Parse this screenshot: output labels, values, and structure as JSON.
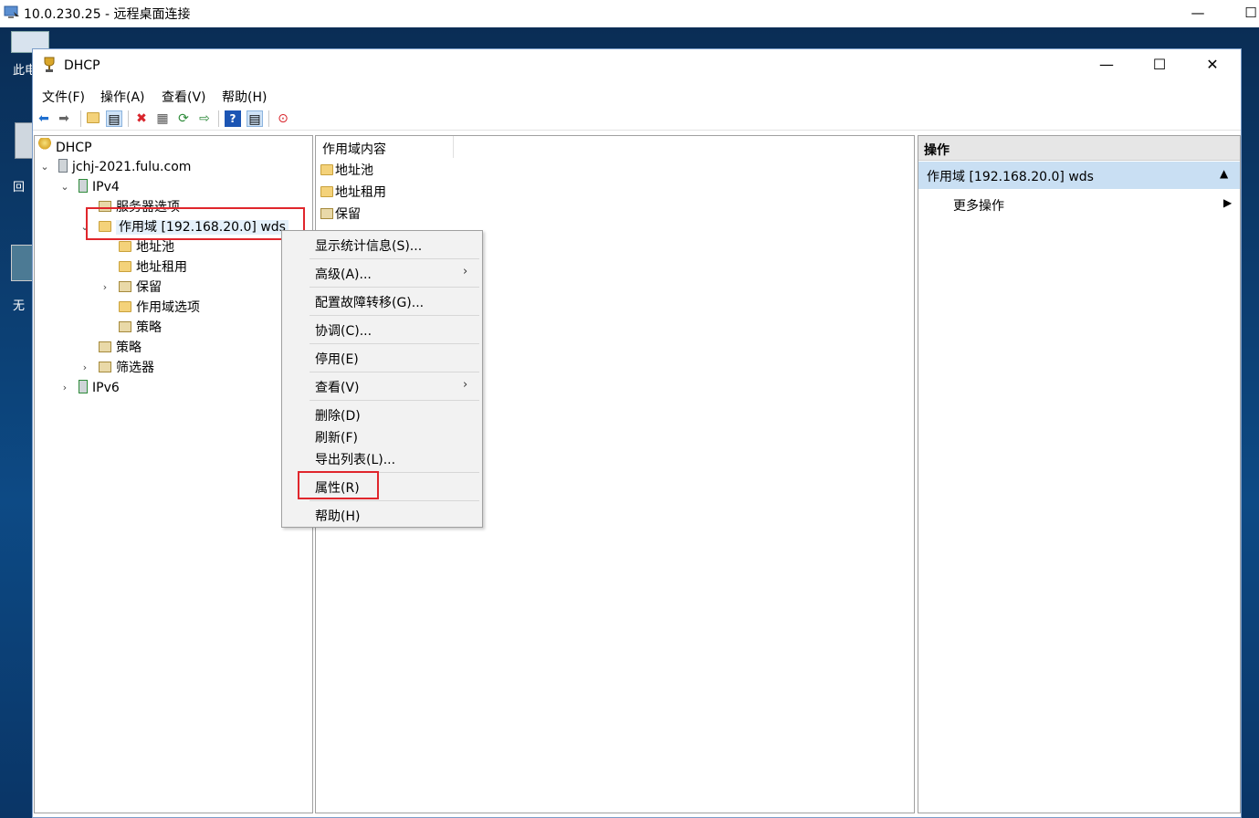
{
  "rdp": {
    "title": "10.0.230.25 - 远程桌面连接",
    "minimize": "—",
    "maximize": "☐"
  },
  "desktop": {
    "labels": [
      "此电",
      "回",
      "无"
    ]
  },
  "window": {
    "title": "DHCP",
    "minimize": "—",
    "maximize": "☐",
    "close": "✕"
  },
  "menubar": [
    "文件(F)",
    "操作(A)",
    "查看(V)",
    "帮助(H)"
  ],
  "toolbar": {
    "icons": [
      "back-arrow-icon",
      "forward-arrow-icon",
      "up-folder-icon",
      "show-hide-tree-icon",
      "delete-icon",
      "properties-icon",
      "refresh-icon",
      "export-list-icon",
      "help-icon",
      "show-hide-action-pane-icon",
      "deactivate-icon"
    ]
  },
  "tree": {
    "root": "DHCP",
    "server": "jchj-2021.fulu.com",
    "ipv4": "IPv4",
    "server_options": "服务器选项",
    "scope": "作用域 [192.168.20.0] wds",
    "scope_children": [
      "地址池",
      "地址租用",
      "保留",
      "作用域选项",
      "策略"
    ],
    "policies": "策略",
    "filters": "筛选器",
    "ipv6": "IPv6"
  },
  "content": {
    "column_header": "作用域内容",
    "items": [
      "地址池",
      "地址租用",
      "保留"
    ]
  },
  "context_menu": {
    "items": [
      {
        "label": "显示统计信息(S)...",
        "submenu": false
      },
      {
        "label": "高级(A)...",
        "submenu": true
      },
      {
        "label": "配置故障转移(G)...",
        "submenu": false
      },
      {
        "label": "协调(C)...",
        "submenu": false
      },
      {
        "label": "停用(E)",
        "submenu": false
      },
      {
        "label": "查看(V)",
        "submenu": true
      },
      {
        "label": "删除(D)",
        "submenu": false
      },
      {
        "label": "刷新(F)",
        "submenu": false
      },
      {
        "label": "导出列表(L)...",
        "submenu": false
      },
      {
        "label": "属性(R)",
        "submenu": false,
        "highlighted": true
      },
      {
        "label": "帮助(H)",
        "submenu": false
      }
    ]
  },
  "actions": {
    "header": "操作",
    "section": "作用域 [192.168.20.0] wds",
    "more": "更多操作"
  },
  "colors": {
    "highlight_box": "#e0262c",
    "actions_section_bg": "#c9dff3"
  }
}
